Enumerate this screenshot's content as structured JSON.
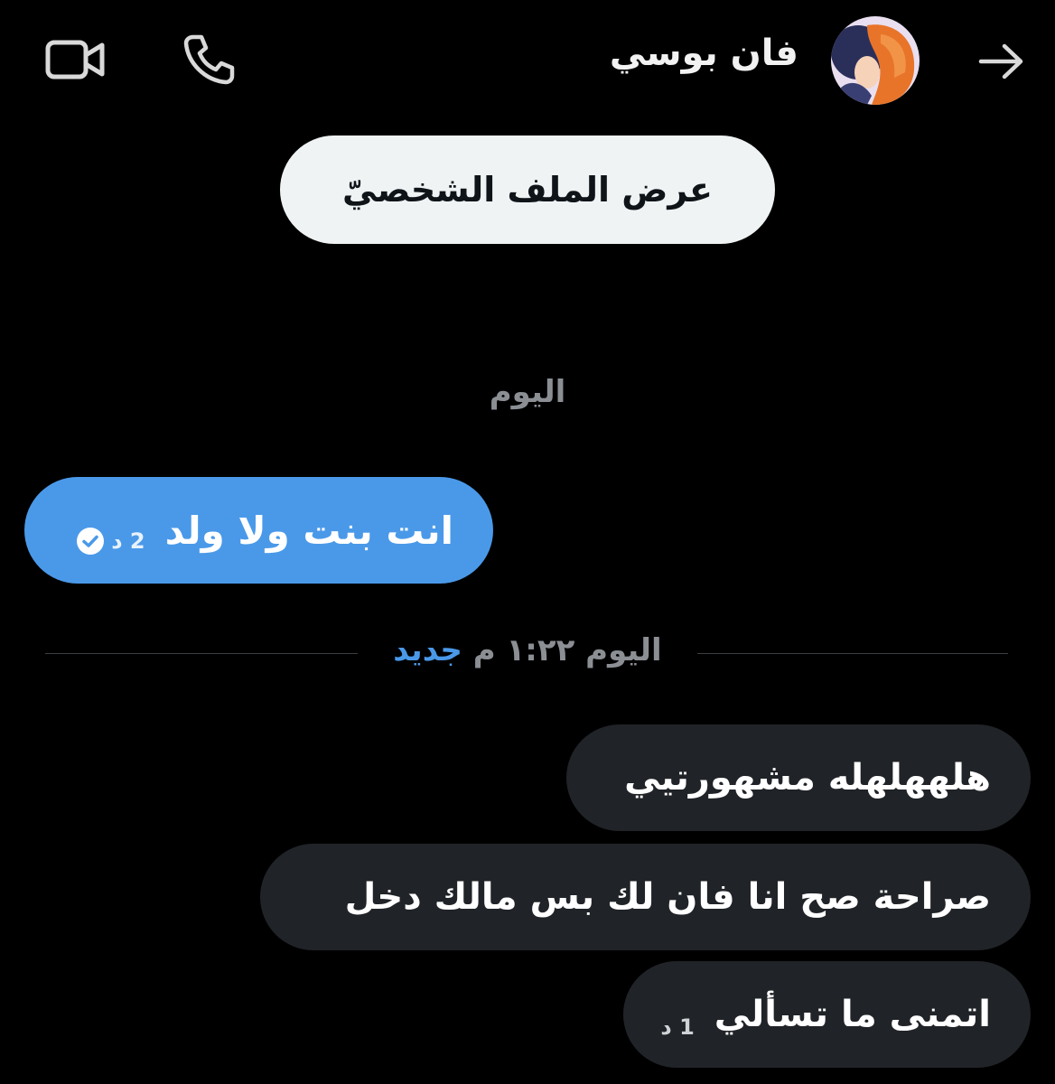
{
  "header": {
    "contact_name": "فان بوسي",
    "back_icon": "arrow-right-icon",
    "avatar_icon": "avatar",
    "call_icon": "phone-icon",
    "video_icon": "video-camera-icon"
  },
  "profile_button": {
    "label": "عرض الملف الشخصيّ"
  },
  "date_separator": {
    "label": "اليوم"
  },
  "sent_messages": [
    {
      "text": "انت بنت ولا ولد",
      "time": "2 د",
      "status_icon": "check-circle-icon"
    }
  ],
  "new_divider": {
    "time_label": "اليوم ١:٢٢ م",
    "new_label": "جديد"
  },
  "received_messages": [
    {
      "text": "هلههلهله مشهورتيي",
      "time": ""
    },
    {
      "text": "صراحة صح انا فان لك بس مالك دخل",
      "time": ""
    },
    {
      "text": "اتمنى ما تسألي",
      "time": "1 د"
    }
  ],
  "colors": {
    "background": "#000000",
    "sent_bubble": "#4a99e9",
    "received_bubble": "#202327",
    "accent": "#4a99e9",
    "muted_text": "#8b8f94",
    "profile_button_bg": "#eff3f4"
  }
}
